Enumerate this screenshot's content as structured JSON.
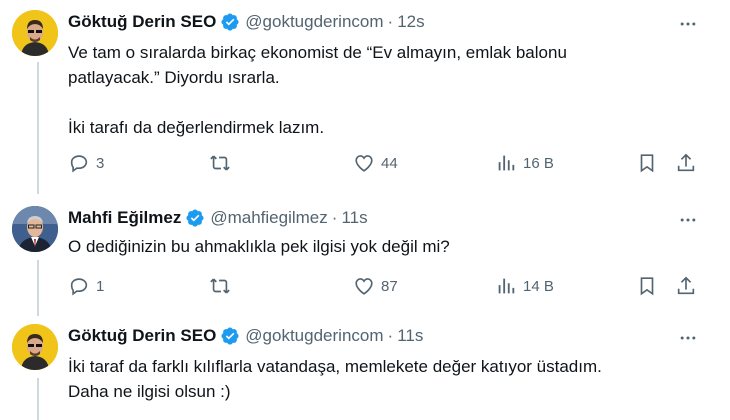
{
  "tweets": [
    {
      "name": "Göktuğ Derin SEO",
      "handle": "@goktugderincom",
      "separator": "·",
      "time": "12s",
      "lines": [
        "Ve tam o sıralarda birkaç ekonomist de “Ev almayın, emlak balonu",
        "patlayacak.” Diyordu ısrarla.",
        "",
        "İki tarafı da değerlendirmek lazım."
      ],
      "replies": "3",
      "retweets": "",
      "likes": "44",
      "views": "16 B"
    },
    {
      "name": "Mahfi Eğilmez",
      "handle": "@mahfiegilmez",
      "separator": "·",
      "time": "11s",
      "lines": [
        "O dediğinizin bu ahmaklıkla pek ilgisi yok değil mi?"
      ],
      "replies": "1",
      "retweets": "",
      "likes": "87",
      "views": "14 B"
    },
    {
      "name": "Göktuğ Derin SEO",
      "handle": "@goktugderincom",
      "separator": "·",
      "time": "11s",
      "lines": [
        "İki taraf da farklı kılıflarla vatandaşa, memlekete değer katıyor üstadım.",
        "Daha ne ilgisi olsun :)"
      ]
    }
  ],
  "colors": {
    "verified": "#1d9bf0",
    "muted": "#536471",
    "thread_line": "#cfd9de",
    "avatar_yellow": "#f0c419"
  },
  "icons": [
    "more-icon",
    "reply-icon",
    "retweet-icon",
    "like-icon",
    "views-icon",
    "bookmark-icon",
    "share-icon",
    "verified-icon"
  ]
}
